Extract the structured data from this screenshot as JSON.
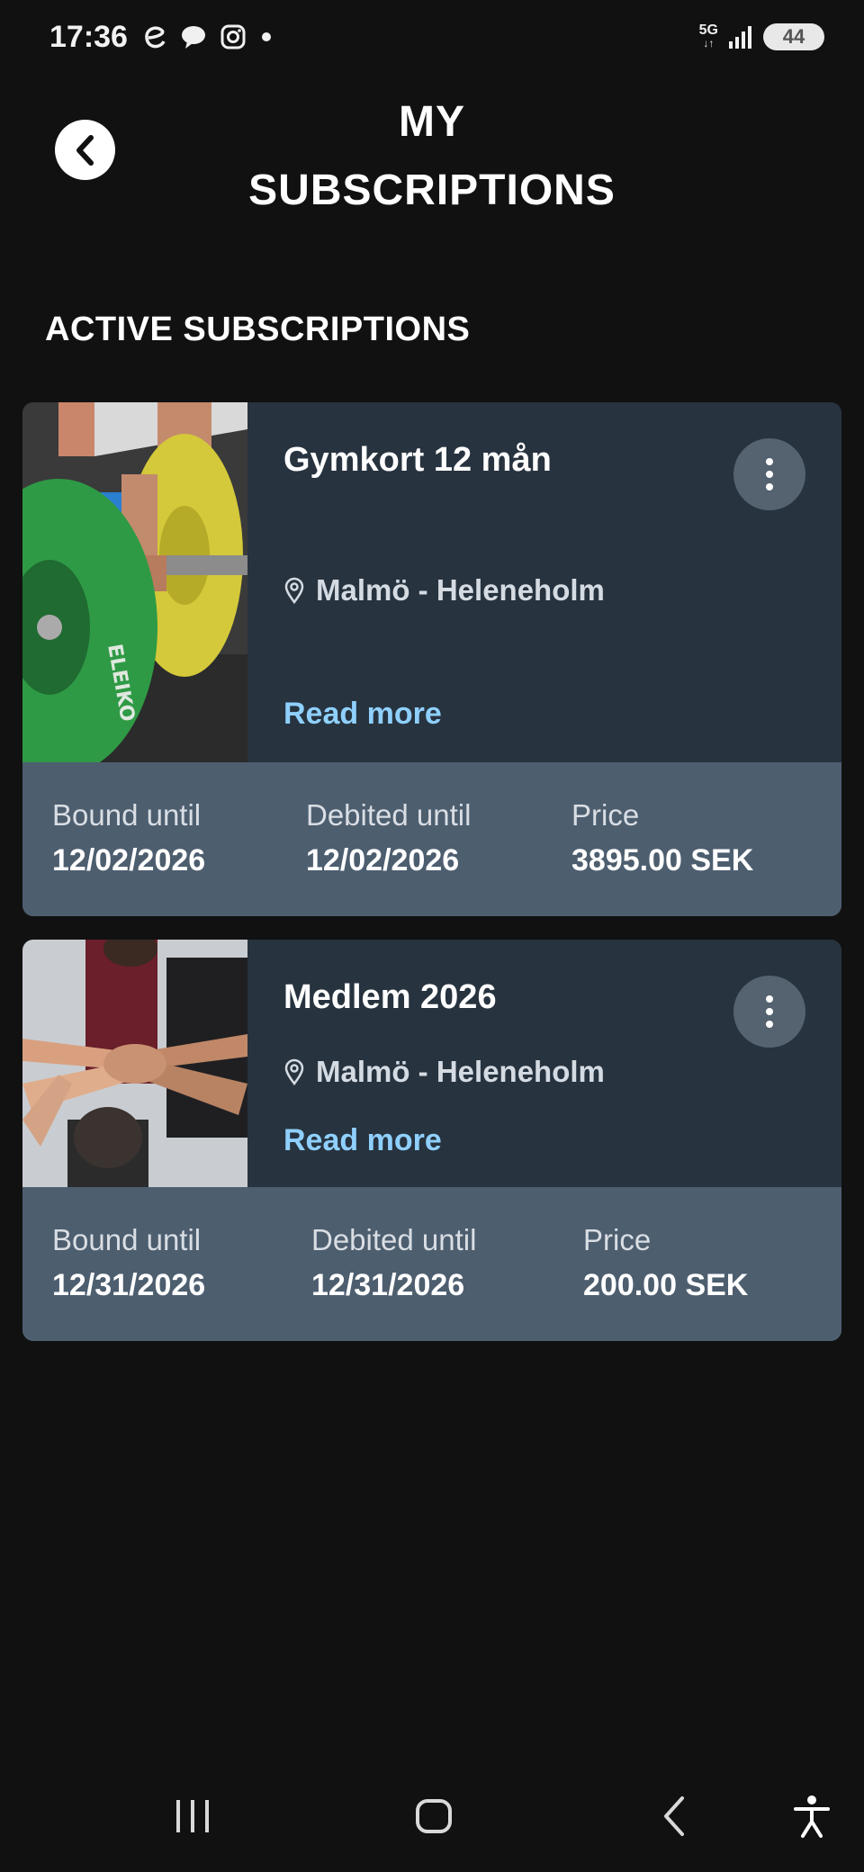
{
  "status_bar": {
    "time": "17:36",
    "battery": "44",
    "network": "5G"
  },
  "header": {
    "title_line1": "MY",
    "title_line2": "SUBSCRIPTIONS"
  },
  "section": {
    "title": "ACTIVE SUBSCRIPTIONS"
  },
  "subscriptions": [
    {
      "name": "Gymkort 12 mån",
      "location": "Malmö - Heleneholm",
      "read_more": "Read more",
      "bound_label": "Bound until",
      "bound_value": "12/02/2026",
      "debited_label": "Debited until",
      "debited_value": "12/02/2026",
      "price_label": "Price",
      "price_value": "3895.00 SEK"
    },
    {
      "name": "Medlem 2026",
      "location": "Malmö - Heleneholm",
      "read_more": "Read more",
      "bound_label": "Bound until",
      "bound_value": "12/31/2026",
      "debited_label": "Debited until",
      "debited_value": "12/31/2026",
      "price_label": "Price",
      "price_value": "200.00 SEK"
    }
  ],
  "colors": {
    "background": "#111111",
    "card_top": "#27333f",
    "card_bottom": "#4d5e6f",
    "link": "#8fd0ff"
  }
}
